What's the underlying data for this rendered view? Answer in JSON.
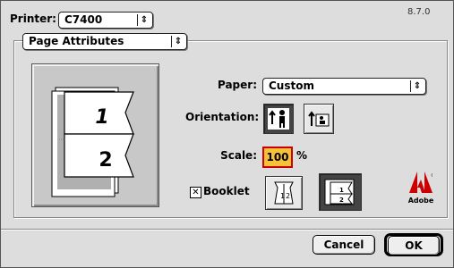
{
  "version": "8.7.0",
  "printer": {
    "label": "Printer:",
    "value": "C7400"
  },
  "panel": {
    "value": "Page Attributes"
  },
  "paper": {
    "label": "Paper:",
    "value": "Custom"
  },
  "orientation": {
    "label": "Orientation:",
    "selected": "portrait"
  },
  "scale": {
    "label": "Scale:",
    "value": "100",
    "unit": "%"
  },
  "booklet": {
    "label": "Booklet",
    "checked": true,
    "selected_layout": "booklet-two-up"
  },
  "preview": {
    "page1": "1",
    "page2": "2"
  },
  "buttons": {
    "cancel": "Cancel",
    "ok": "OK"
  },
  "logo": {
    "text": "Adobe",
    "color": "#cc0000"
  }
}
